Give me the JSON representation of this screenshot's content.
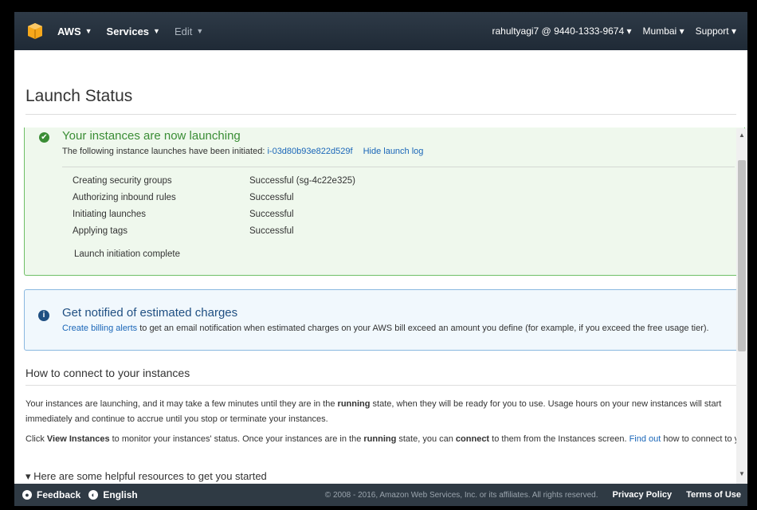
{
  "topbar": {
    "aws_label": "AWS",
    "services_label": "Services",
    "edit_label": "Edit",
    "account": "rahultyagi7 @ 9440-1333-9674",
    "region": "Mumbai",
    "support": "Support"
  },
  "page": {
    "title": "Launch Status"
  },
  "success_panel": {
    "title": "Your instances are now launching",
    "subtitle": "The following instance launches have been initiated:",
    "instance_id": "i-03d80b93e822d529f",
    "hide_log": "Hide launch log",
    "steps": [
      {
        "name": "Creating security groups",
        "status": "Successful (sg-4c22e325)"
      },
      {
        "name": "Authorizing inbound rules",
        "status": "Successful"
      },
      {
        "name": "Initiating launches",
        "status": "Successful"
      },
      {
        "name": "Applying tags",
        "status": "Successful"
      }
    ],
    "complete": "Launch initiation complete"
  },
  "info_panel": {
    "title": "Get notified of estimated charges",
    "link": "Create billing alerts",
    "text": " to get an email notification when estimated charges on your AWS bill exceed an amount you define (for example, if you exceed the free usage tier)."
  },
  "connect": {
    "heading": "How to connect to your instances",
    "p1_a": "Your instances are launching, and it may take a few minutes until they are in the ",
    "p1_b": "running",
    "p1_c": " state, when they will be ready for you to use. Usage hours on your new instances will start immediately and continue to accrue until you stop or terminate your instances.",
    "p2_a": "Click ",
    "p2_b": "View Instances",
    "p2_c": " to monitor your instances' status. Once your instances are in the ",
    "p2_d": "running",
    "p2_e": " state, you can ",
    "p2_f": "connect",
    "p2_g": " to them from the Instances screen. ",
    "p2_link": "Find out",
    "p2_h": " how to connect to your instances.",
    "cut_text": "▾ Here are some helpful resources to get you started"
  },
  "footer": {
    "feedback": "Feedback",
    "language": "English",
    "copyright": "© 2008 - 2016, Amazon Web Services, Inc. or its affiliates. All rights reserved.",
    "privacy": "Privacy Policy",
    "terms": "Terms of Use"
  }
}
